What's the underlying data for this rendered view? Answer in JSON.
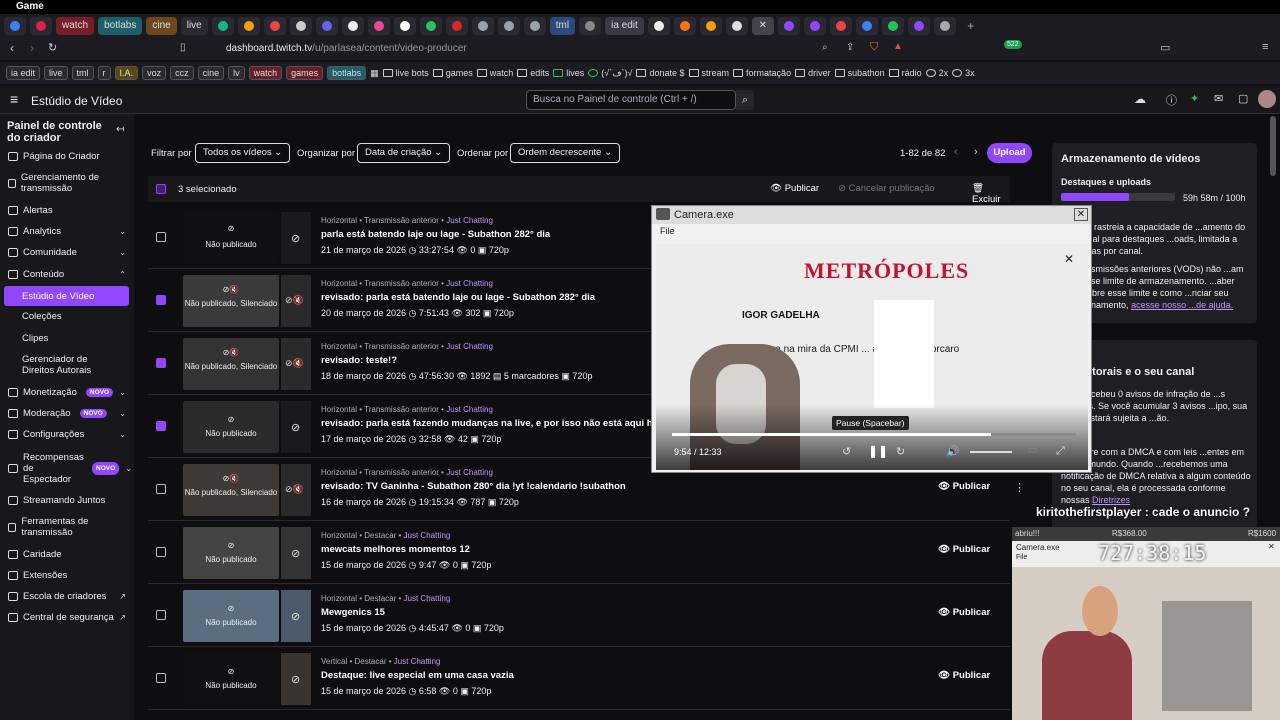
{
  "window": {
    "title": "Game"
  },
  "tabs": [
    "watch",
    "botlabs",
    "cine",
    "live",
    "tml",
    "ia edit"
  ],
  "url": {
    "host": "dashboard.twitch.tv",
    "path": "/u/parlasea/content/video-producer"
  },
  "bookmarks": {
    "pills": [
      "ia edit",
      "live",
      "tml",
      "r",
      "I.A.",
      "voz",
      "ccz",
      "cine",
      "lv",
      "watch",
      "games",
      "botlabs"
    ],
    "folders": [
      "live bots",
      "games",
      "watch",
      "edits",
      "lives",
      "(√`ڡ`)√",
      "donate $",
      "stream",
      "formatação",
      "driver",
      "subathon",
      "rádio",
      "2x",
      "3x"
    ]
  },
  "header": {
    "title": "Estúdio de Vídeo",
    "search_placeholder": "Busca no Painel de controle (Ctrl + /)"
  },
  "sidebar": {
    "title": "Painel de controle do criador",
    "items": [
      {
        "label": "Página do Criador"
      },
      {
        "label": "Gerenciamento de transmissão"
      },
      {
        "label": "Alertas"
      },
      {
        "label": "Analytics"
      },
      {
        "label": "Comunidade"
      },
      {
        "label": "Conteúdo"
      },
      {
        "label": "Estúdio de Vídeo"
      },
      {
        "label": "Coleções"
      },
      {
        "label": "Clipes"
      },
      {
        "label": "Gerenciador de Direitos Autorais"
      },
      {
        "label": "Monetização"
      },
      {
        "label": "Moderação"
      },
      {
        "label": "Configurações"
      },
      {
        "label": "Recompensas de Espectador"
      },
      {
        "label": "Streamando Juntos"
      },
      {
        "label": "Ferramentas de transmissão"
      },
      {
        "label": "Caridade"
      },
      {
        "label": "Extensões"
      },
      {
        "label": "Escola de criadores"
      },
      {
        "label": "Central de segurança"
      }
    ],
    "new_badge": "NOVO"
  },
  "filters": {
    "filter_label": "Filtrar por",
    "filter_value": "Todos os vídeos",
    "sort_label": "Organizar por",
    "sort_value": "Data de criação",
    "order_label": "Ordenar por",
    "order_value": "Ordem decrescente",
    "pagination": "1-82 de 82",
    "upload": "Upload"
  },
  "bulk": {
    "selected": "3 selecionado",
    "publish": "Publicar",
    "cancel": "Cancelar publicação",
    "delete": "Excluir"
  },
  "videos": [
    {
      "meta": "Horizontal • Transmissão anterior • ",
      "cat": "Just Chatting",
      "title": "parla está batendo laje ou lage - Subathon 282° dia",
      "info": "21 de março de 2026  ◷ 33:27:54  👁 0  ▣ 720p",
      "status": "Não publicado",
      "checked": false
    },
    {
      "meta": "Horizontal • Transmissão anterior • ",
      "cat": "Just Chatting",
      "title": "revisado: parla está batendo laje ou lage - Subathon 282° dia",
      "info": "20 de março de 2026  ◷ 7:51:43  👁 302  ▣ 720p",
      "status": "Não publicado, Silenciado",
      "checked": true
    },
    {
      "meta": "Horizontal • Transmissão anterior • ",
      "cat": "Just Chatting",
      "title": "revisado: teste!?",
      "info": "18 de março de 2026  ◷ 47:56:30  👁 1892  ▤ 5 marcadores  ▣ 720p",
      "status": "Não publicado, Silenciado",
      "checked": true
    },
    {
      "meta": "Horizontal • Transmissão anterior • ",
      "cat": "Just Chatting",
      "title": "revisado: parla está fazendo mudanças na live, e por isso não está aqui hoje - Sub",
      "info": "17 de março de 2026  ◷ 32:58  👁 42  ▣ 720p",
      "status": "Não publicado",
      "checked": true
    },
    {
      "meta": "Horizontal • Transmissão anterior • ",
      "cat": "Just Chatting",
      "title": "revisado: TV Ganinha - Subathon 280° dia !yt !calendario !subathon",
      "info": "16 de março de 2026  ◷ 19:15:34  👁 787  ▣ 720p",
      "status": "Não publicado, Silenciado",
      "checked": false
    },
    {
      "meta": "Horizontal • Destacar • ",
      "cat": "Just Chatting",
      "title": "mewcats melhores momentos 12",
      "info": "15 de março de 2026  ◷ 9:47  👁 0  ▣ 720p",
      "status": "Não publicado",
      "checked": false
    },
    {
      "meta": "Horizontal • Destacar • ",
      "cat": "Just Chatting",
      "title": "Mewgenics 15",
      "info": "15 de março de 2026  ◷ 4:45:47  👁 0  ▣ 720p",
      "status": "Não publicado",
      "checked": false
    },
    {
      "meta": "Vertical • Destacar • ",
      "cat": "Just Chatting",
      "title": "Destaque: live especial em uma casa vazia",
      "info": "15 de março de 2026  ◷ 6:58  👁 0  ▣ 720p",
      "status": "Não publicado",
      "checked": false
    }
  ],
  "publish_label": "Publicar",
  "storage": {
    "title": "Armazenamento de vídeos",
    "sub": "Destaques e uploads",
    "usage": "59h 58m / 100h",
    "fill": 0.6,
    "p1": "...dador rastreia a capacidade de ...amento do seu canal para destaques ...oads, limitada a 100 horas por canal.",
    "p2": "...s transmissões anteriores (VODs) não ...am para esse limite de armazenamento. ...aber mais sobre esse limite e como ...nciar seu armazenamento,",
    "link": "acesse nosso ...de ajuda."
  },
  "rights": {
    "title": "...s autorais e o seu canal",
    "p1": "...nal recebeu 0 avisos de infração de ...s autorais. Se você acumular 3 avisos ...ipo, sua conta estará sujeita a ...ão.",
    "p2": "...cumpre com a DMCA e com leis ...entes em todo o mundo. Quando ...recebemos uma notificação de DMCA relativa a algum conteúdo no seu canal, ela é processada conforme nossas",
    "link": "Diretrizes"
  },
  "camera": {
    "title": "Camera.exe",
    "menu": "File",
    "time": "9:54 / 12:33",
    "tooltip": "Pause (Spacebar)",
    "progress": 0.79,
    "headline": "METRÓPOLES",
    "author": "IGOR GADELHA",
    "article": "entra na mira da CPMI ... a dados de Vorcaro"
  },
  "overlay": {
    "chat": "kiritothefirstplayer : cade o anuncio ?",
    "bar_left": "abriu!!!",
    "bar_mid": "R$368.00",
    "bar_right": "R$1600",
    "window_title": "Camera.exe",
    "window_menu": "File",
    "timer": "727:38:15"
  }
}
